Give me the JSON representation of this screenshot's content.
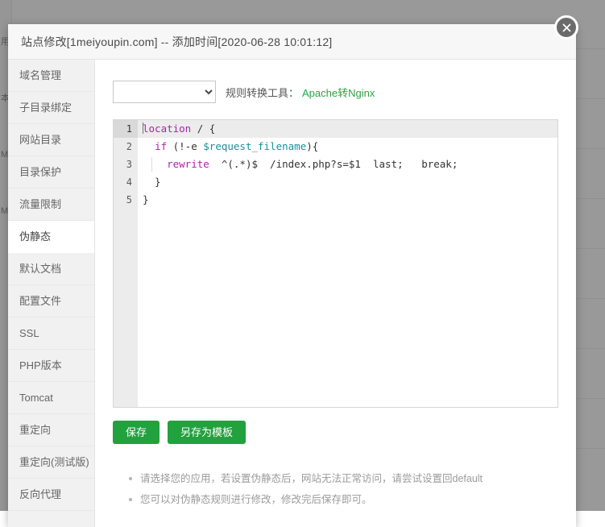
{
  "background": {
    "sidebar_glyphs": [
      "用",
      "本",
      "M",
      "M"
    ],
    "row_count": 9
  },
  "modal": {
    "title": "站点修改[1meiyoupin.com] -- 添加时间[2020-06-28 10:01:12]",
    "close_icon": "close-icon",
    "site_domain": "1meiyoupin.com",
    "added_time": "2020-06-28 10:01:12"
  },
  "sidebar": {
    "items": [
      {
        "label": "域名管理",
        "active": false
      },
      {
        "label": "子目录绑定",
        "active": false
      },
      {
        "label": "网站目录",
        "active": false
      },
      {
        "label": "目录保护",
        "active": false
      },
      {
        "label": "流量限制",
        "active": false
      },
      {
        "label": "伪静态",
        "active": true
      },
      {
        "label": "默认文档",
        "active": false
      },
      {
        "label": "配置文件",
        "active": false
      },
      {
        "label": "SSL",
        "active": false
      },
      {
        "label": "PHP版本",
        "active": false
      },
      {
        "label": "Tomcat",
        "active": false
      },
      {
        "label": "重定向",
        "active": false
      },
      {
        "label": "重定向(测试版)",
        "active": false
      },
      {
        "label": "反向代理",
        "active": false
      }
    ]
  },
  "toolbar": {
    "select_value": "",
    "select_options": [
      ""
    ],
    "converter_label": "规则转换工具：",
    "converter_link": "Apache转Nginx",
    "converter_link_color": "#26a644"
  },
  "editor": {
    "active_line": 1,
    "line_numbers": [
      "1",
      "2",
      "3",
      "4",
      "5"
    ],
    "lines": [
      {
        "number": "1",
        "tokens": [
          {
            "text": "location",
            "type": "kw"
          },
          {
            "text": " / {",
            "type": "plain"
          }
        ]
      },
      {
        "number": "2",
        "tokens": [
          {
            "text": "  ",
            "type": "plain"
          },
          {
            "text": "if",
            "type": "kw"
          },
          {
            "text": " (!-e ",
            "type": "plain"
          },
          {
            "text": "$request_filename",
            "type": "var"
          },
          {
            "text": "){",
            "type": "plain"
          }
        ]
      },
      {
        "number": "3",
        "tokens": [
          {
            "text": "    ",
            "type": "plain"
          },
          {
            "text": "rewrite",
            "type": "kw"
          },
          {
            "text": "  ^(.*)$  /index.php?s=$1  last;   break;",
            "type": "plain"
          }
        ]
      },
      {
        "number": "4",
        "tokens": [
          {
            "text": "  }",
            "type": "plain"
          }
        ]
      },
      {
        "number": "5",
        "tokens": [
          {
            "text": "}",
            "type": "plain"
          }
        ]
      }
    ],
    "plain_text": "location / {\n  if (!-e $request_filename){\n    rewrite  ^(.*)$  /index.php?s=$1  last;   break;\n  }\n}"
  },
  "buttons": {
    "save": "保存",
    "save_as_template": "另存为模板",
    "color": "#22a13f"
  },
  "tips": [
    "请选择您的应用，若设置伪静态后，网站无法正常访问，请尝试设置回default",
    "您可以对伪静态规则进行修改，修改完后保存即可。"
  ]
}
